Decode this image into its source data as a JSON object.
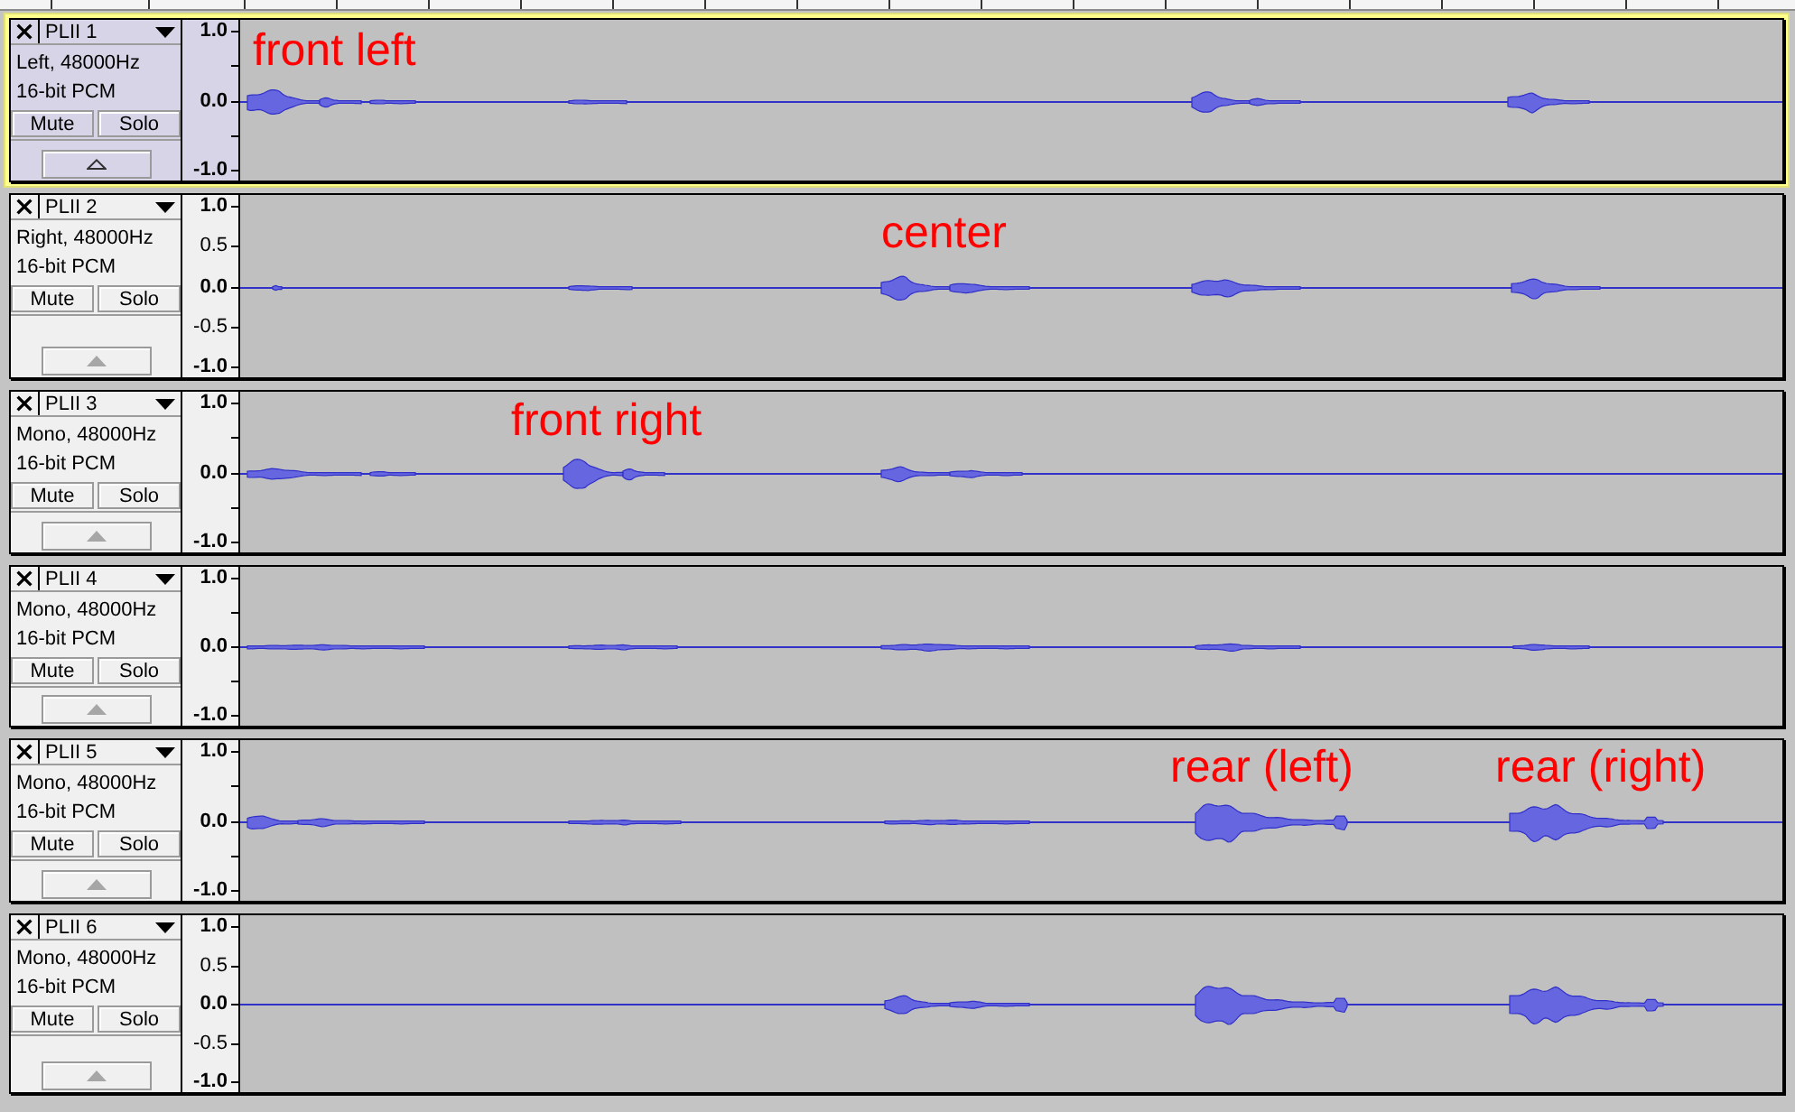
{
  "tracks": [
    {
      "name": "PLII 1",
      "selected": true,
      "channel_info": "Left, 48000Hz",
      "sample_format": "16-bit PCM",
      "mute_label": "Mute",
      "solo_label": "Solo",
      "scale": [
        {
          "text": "1.0",
          "kind": "major"
        },
        {
          "text": "0.0",
          "kind": "major"
        },
        {
          "text": "-1.0",
          "kind": "major"
        }
      ],
      "annotations": [
        "front left"
      ]
    },
    {
      "name": "PLII 2",
      "selected": false,
      "channel_info": "Right, 48000Hz",
      "sample_format": "16-bit PCM",
      "mute_label": "Mute",
      "solo_label": "Solo",
      "scale": [
        {
          "text": "1.0",
          "kind": "major"
        },
        {
          "text": "0.5",
          "kind": "minor"
        },
        {
          "text": "0.0",
          "kind": "major"
        },
        {
          "text": "-0.5",
          "kind": "minor"
        },
        {
          "text": "-1.0",
          "kind": "major"
        }
      ],
      "annotations": [
        "center"
      ]
    },
    {
      "name": "PLII 3",
      "selected": false,
      "channel_info": "Mono, 48000Hz",
      "sample_format": "16-bit PCM",
      "mute_label": "Mute",
      "solo_label": "Solo",
      "scale": [
        {
          "text": "1.0",
          "kind": "major"
        },
        {
          "text": "0.0",
          "kind": "major"
        },
        {
          "text": "-1.0",
          "kind": "major"
        }
      ],
      "annotations": [
        "front right"
      ]
    },
    {
      "name": "PLII 4",
      "selected": false,
      "channel_info": "Mono, 48000Hz",
      "sample_format": "16-bit PCM",
      "mute_label": "Mute",
      "solo_label": "Solo",
      "scale": [
        {
          "text": "1.0",
          "kind": "major"
        },
        {
          "text": "0.0",
          "kind": "major"
        },
        {
          "text": "-1.0",
          "kind": "major"
        }
      ]
    },
    {
      "name": "PLII 5",
      "selected": false,
      "channel_info": "Mono, 48000Hz",
      "sample_format": "16-bit PCM",
      "mute_label": "Mute",
      "solo_label": "Solo",
      "scale": [
        {
          "text": "1.0",
          "kind": "major"
        },
        {
          "text": "0.0",
          "kind": "major"
        },
        {
          "text": "-1.0",
          "kind": "major"
        }
      ],
      "annotations": [
        "rear (left)",
        "rear (right)"
      ]
    },
    {
      "name": "PLII 6",
      "selected": false,
      "channel_info": "Mono, 48000Hz",
      "sample_format": "16-bit PCM",
      "mute_label": "Mute",
      "solo_label": "Solo",
      "scale": [
        {
          "text": "1.0",
          "kind": "major"
        },
        {
          "text": "0.5",
          "kind": "minor"
        },
        {
          "text": "0.0",
          "kind": "major"
        },
        {
          "text": "-0.5",
          "kind": "minor"
        },
        {
          "text": "-1.0",
          "kind": "major"
        }
      ]
    }
  ]
}
